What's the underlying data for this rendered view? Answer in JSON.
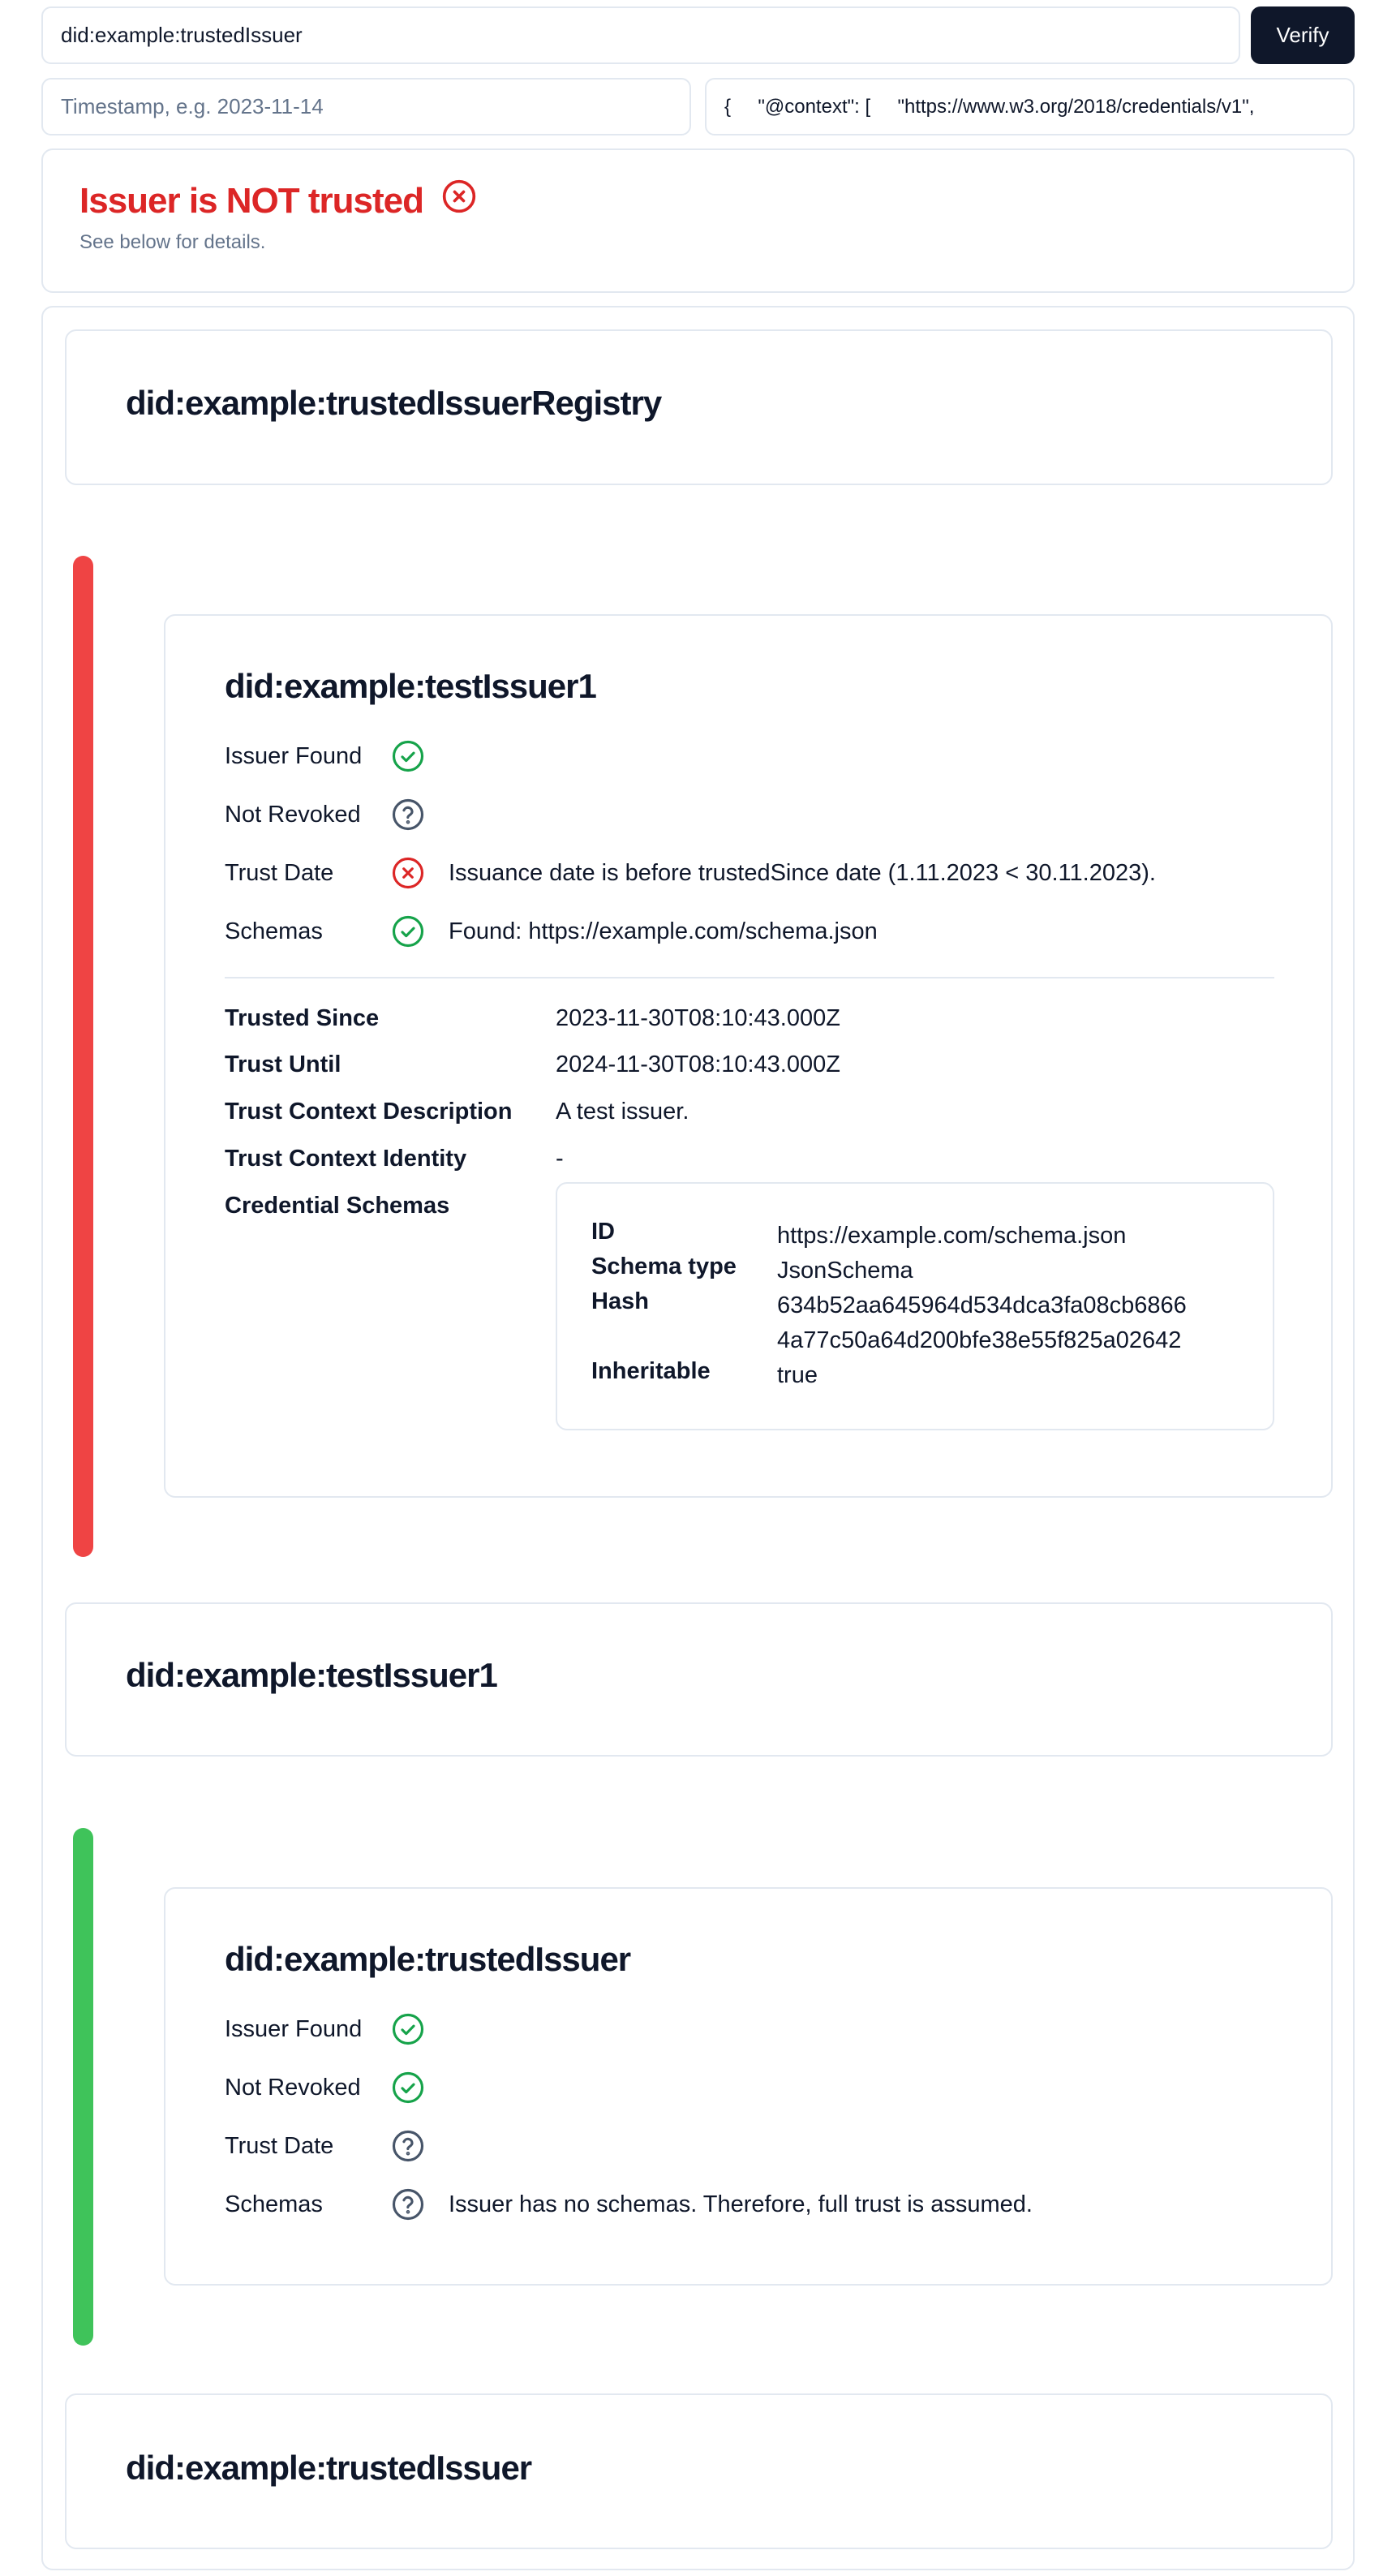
{
  "form": {
    "issuer_value": "did:example:trustedIssuer",
    "verify_label": "Verify",
    "timestamp_placeholder": "Timestamp, e.g. 2023-11-14",
    "credential_value": "{     \"@context\": [     \"https://www.w3.org/2018/credentials/v1\","
  },
  "status": {
    "title": "Issuer is NOT trusted",
    "subtitle": "See below for details.",
    "color": "#dc2626"
  },
  "colors": {
    "success": "#16a34a",
    "error": "#dc2626",
    "unknown": "#475569",
    "bar_fail": "#ef4444",
    "bar_pass": "#3fc35a"
  },
  "chain": {
    "registry": {
      "title": "did:example:trustedIssuerRegistry"
    },
    "issuer1_detail": {
      "title": "did:example:testIssuer1",
      "checks": [
        {
          "label": "Issuer Found",
          "state": "ok",
          "message": ""
        },
        {
          "label": "Not Revoked",
          "state": "unknown",
          "message": ""
        },
        {
          "label": "Trust Date",
          "state": "fail",
          "message": "Issuance date is before trustedSince date (1.11.2023 < 30.11.2023)."
        },
        {
          "label": "Schemas",
          "state": "ok",
          "message": "Found: https://example.com/schema.json"
        }
      ],
      "details": {
        "trusted_since_label": "Trusted Since",
        "trusted_since": "2023-11-30T08:10:43.000Z",
        "trust_until_label": "Trust Until",
        "trust_until": "2024-11-30T08:10:43.000Z",
        "context_desc_label": "Trust Context Description",
        "context_desc": "A test issuer.",
        "context_identity_label": "Trust Context Identity",
        "context_identity": "-",
        "schemas_label": "Credential Schemas"
      },
      "schema": {
        "id_label": "ID",
        "id": "https://example.com/schema.json",
        "type_label": "Schema type",
        "type": "JsonSchema",
        "hash_label": "Hash",
        "hash_line1": "634b52aa645964d534dca3fa08cb6866",
        "hash_line2": "4a77c50a64d200bfe38e55f825a02642",
        "inheritable_label": "Inheritable",
        "inheritable": "true"
      }
    },
    "issuer1": {
      "title": "did:example:testIssuer1"
    },
    "trusted_detail": {
      "title": "did:example:trustedIssuer",
      "checks": [
        {
          "label": "Issuer Found",
          "state": "ok",
          "message": ""
        },
        {
          "label": "Not Revoked",
          "state": "ok",
          "message": ""
        },
        {
          "label": "Trust Date",
          "state": "unknown",
          "message": ""
        },
        {
          "label": "Schemas",
          "state": "unknown",
          "message": "Issuer has no schemas. Therefore, full trust is assumed."
        }
      ]
    },
    "trusted": {
      "title": "did:example:trustedIssuer"
    }
  }
}
